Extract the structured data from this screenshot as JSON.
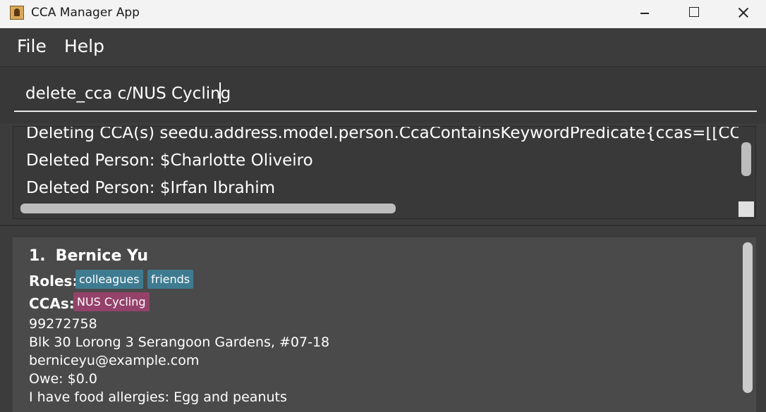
{
  "window": {
    "title": "CCA Manager App"
  },
  "menu": {
    "file": "File",
    "help": "Help"
  },
  "command": {
    "value": "delete_cca c/NUS Cycling"
  },
  "result": {
    "lines": [
      "Deleting CCA(s) seedu.address.model.person.CcaContainsKeywordPredicate{ccas=[[CCA: NUS",
      "Deleted Person: $Charlotte Oliveiro",
      "Deleted Person: $Irfan Ibrahim"
    ]
  },
  "persons": [
    {
      "index": "1.",
      "name": "Bernice Yu",
      "roles_label": "Roles:",
      "roles": [
        "colleagues",
        "friends"
      ],
      "ccas_label": "CCAs:",
      "ccas": [
        "NUS Cycling"
      ],
      "phone": "99272758",
      "address": "Blk 30 Lorong 3 Serangoon Gardens, #07-18",
      "email": "berniceyu@example.com",
      "owe": "Owe: $0.0",
      "remark": "I have food allergies: Egg and peanuts"
    }
  ],
  "colors": {
    "background": "#3c3c3c",
    "card": "#4a4a4a",
    "role_tag": "#3e7b91",
    "cca_tag": "#94426a"
  }
}
